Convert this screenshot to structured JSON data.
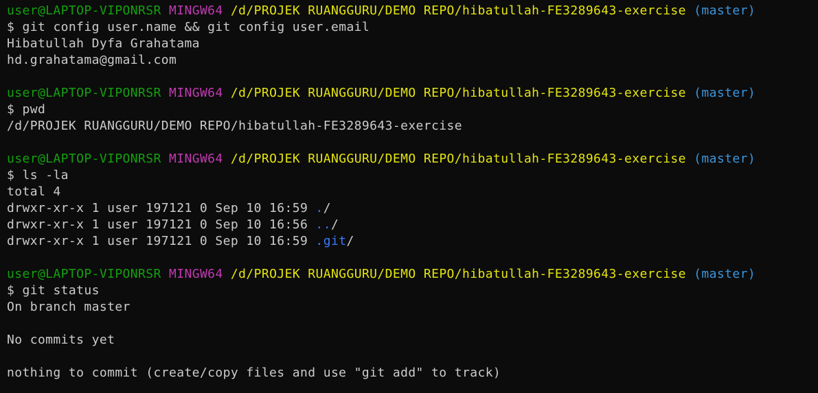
{
  "prompt": {
    "user_host": "user@LAPTOP-VIPONRSR",
    "system": "MINGW64",
    "path": "/d/PROJEK RUANGGURU/DEMO REPO/hibatullah-FE3289643-exercise",
    "branch": "(master)",
    "symbol": "$"
  },
  "blocks": [
    {
      "command": "git config user.name && git config user.email",
      "output": [
        "Hibatullah Dyfa Grahatama",
        "hd.grahatama@gmail.com"
      ]
    },
    {
      "command": "pwd",
      "output": [
        "/d/PROJEK RUANGGURU/DEMO REPO/hibatullah-FE3289643-exercise"
      ]
    },
    {
      "command": "ls -la",
      "output_total": "total 4",
      "entries": [
        {
          "meta": "drwxr-xr-x 1 user 197121 0 Sep 10 16:59",
          "name": "./",
          "dir_part": ".",
          "slash": "/"
        },
        {
          "meta": "drwxr-xr-x 1 user 197121 0 Sep 10 16:56",
          "name": "../",
          "dir_part": "..",
          "slash": "/"
        },
        {
          "meta": "drwxr-xr-x 1 user 197121 0 Sep 10 16:59",
          "name": ".git/",
          "dir_part": ".git",
          "slash": "/"
        }
      ]
    },
    {
      "command": "git status",
      "output": [
        "On branch master",
        "",
        "No commits yet",
        "",
        "nothing to commit (create/copy files and use \"git add\" to track)"
      ]
    }
  ],
  "colors": {
    "background": "#0c0c0c",
    "text": "#cccccc",
    "user": "#13a10e",
    "system": "#c239b3",
    "path": "#e5e510",
    "branch": "#3a96dd",
    "directory": "#3b78ff"
  }
}
